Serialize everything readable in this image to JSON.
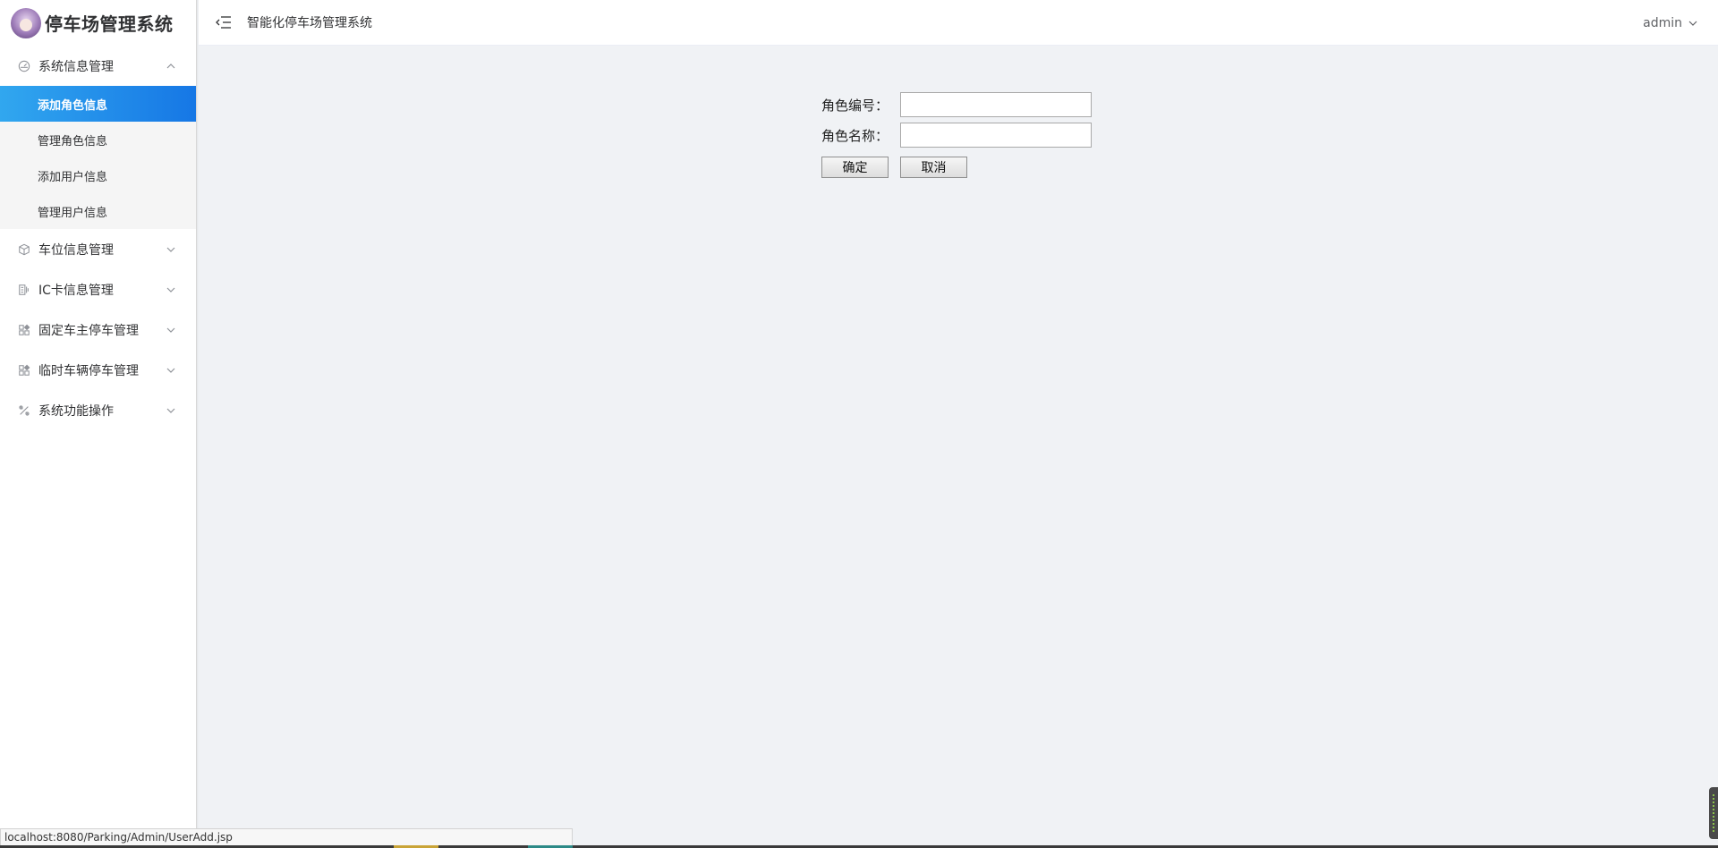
{
  "app": {
    "logo_title": "停车场管理系统",
    "header_title": "智能化停车场管理系统",
    "user": "admin"
  },
  "sidebar": {
    "groups": [
      {
        "label": "系统信息管理",
        "icon": "dashboard-icon",
        "expanded": true,
        "items": [
          {
            "label": "添加角色信息",
            "active": true
          },
          {
            "label": "管理角色信息",
            "active": false
          },
          {
            "label": "添加用户信息",
            "active": false
          },
          {
            "label": "管理用户信息",
            "active": false
          }
        ]
      },
      {
        "label": "车位信息管理",
        "icon": "cube-icon",
        "expanded": false
      },
      {
        "label": "IC卡信息管理",
        "icon": "card-icon",
        "expanded": false
      },
      {
        "label": "固定车主停车管理",
        "icon": "grid-icon",
        "expanded": false
      },
      {
        "label": "临时车辆停车管理",
        "icon": "grid-icon",
        "expanded": false
      },
      {
        "label": "系统功能操作",
        "icon": "tools-icon",
        "expanded": false
      }
    ]
  },
  "form": {
    "role_id_label": "角色编号：",
    "role_id_value": "",
    "role_name_label": "角色名称：",
    "role_name_value": "",
    "confirm_label": "确定",
    "cancel_label": "取消"
  },
  "status_bar": {
    "url": "localhost:8080/Parking/Admin/UserAdd.jsp"
  },
  "colors": {
    "active_gradient_start": "#31a7ef",
    "active_gradient_end": "#1677e5",
    "content_bg": "#f0f2f5"
  }
}
